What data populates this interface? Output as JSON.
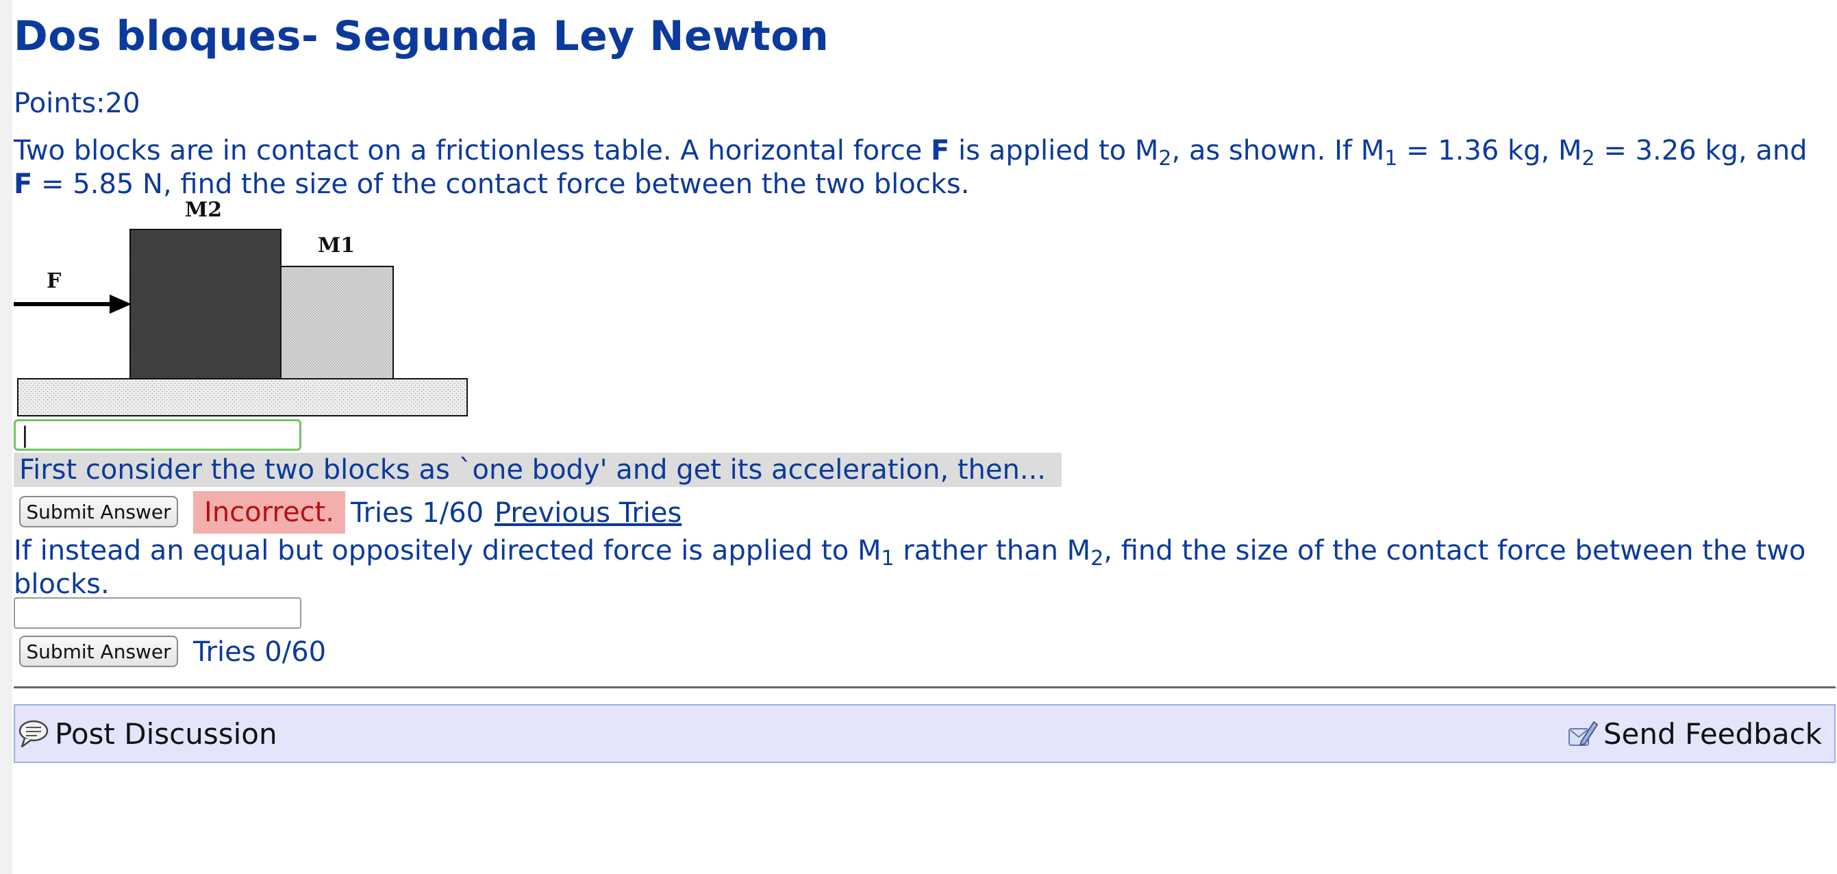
{
  "title": "Dos bloques- Segunda Ley Newton",
  "points": "Points:20",
  "problem": {
    "t1": "Two blocks are in contact on a frictionless table. A horizontal force ",
    "f1": "F",
    "t2": " is applied to M",
    "s1": "2",
    "t3": ", as shown. If M",
    "s2": "1",
    "t4": " = 1.36 kg, M",
    "s3": "2",
    "t5": " = 3.26 kg, and ",
    "f2": "F",
    "t6": " = 5.85 N, find the size of the contact force between the two blocks."
  },
  "figure": {
    "force_label": "F",
    "block_left_label": "M2",
    "block_right_label": "M1"
  },
  "answer1": {
    "value": "|"
  },
  "hint": "First consider the two blocks as `one body' and get its acceleration, then...",
  "submit1": "Submit Answer",
  "status1": "Incorrect.",
  "tries1": "Tries 1/60",
  "previous_tries": "Previous Tries",
  "part2": {
    "t1": "If instead an equal but oppositely directed force is applied to M",
    "s1": "1",
    "t2": " rather than M",
    "s2": "2",
    "t3": ", find the size of the contact force between the two blocks."
  },
  "answer2": {
    "value": ""
  },
  "submit2": "Submit Answer",
  "tries2": "Tries 0/60",
  "footer": {
    "post_discussion": "Post Discussion",
    "send_feedback": "Send Feedback",
    "post_icon": "speech-bubble-icon",
    "feedback_icon": "feedback-pencil-icon"
  },
  "colors": {
    "text_blue": "#0b3a9c",
    "incorrect_bg": "#f4aeae",
    "incorrect_text": "#b31313",
    "hint_bg": "#dcdcdc",
    "footer_bg": "#e4e4fb",
    "active_input_border": "#6dc75a"
  }
}
